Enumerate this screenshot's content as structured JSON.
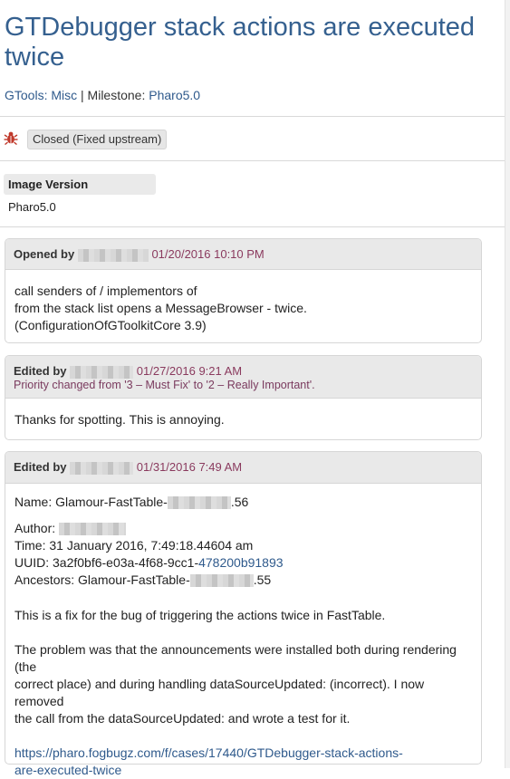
{
  "case": {
    "title": "GTDebugger stack actions are executed twice",
    "project": "GTools: Misc",
    "milestone_label": "Milestone:",
    "milestone": "Pharo5.0",
    "separator": "|",
    "status": "Closed (Fixed upstream)"
  },
  "image_version": {
    "label": "Image Version",
    "value": "Pharo5.0"
  },
  "events": [
    {
      "action": "Opened by",
      "date": "01/20/2016 10:10 PM",
      "lines": [
        "call senders of / implementors of",
        "from the stack list opens a MessageBrowser - twice.",
        "(ConfigurationOfGToolkitCore 3.9)"
      ]
    },
    {
      "action": "Edited by",
      "date": "01/27/2016 9:21 AM",
      "change": "Priority changed from '3 – Must Fix' to '2 – Really Important'.",
      "lines": [
        "Thanks for spotting. This is annoying."
      ]
    },
    {
      "action": "Edited by",
      "date": "01/31/2016 7:49 AM",
      "name_prefix": "Name: Glamour-FastTable-",
      "name_suffix": ".56",
      "author_label": "Author:",
      "time": "Time: 31 January 2016, 7:49:18.44604 am",
      "uuid_prefix": "UUID: 3a2f0bf6-e03a-4f68-9cc1-",
      "uuid_link": "478200b91893",
      "ancestors_prefix": "Ancestors: Glamour-FastTable-",
      "ancestors_suffix": ".55",
      "para1": "This is a fix for the bug of triggering the actions twice in FastTable.",
      "para2_lines": [
        "The problem was that the announcements were installed both during rendering (the",
        "correct place) and during handling dataSourceUpdated: (incorrect). I now removed",
        "the call from the dataSourceUpdated: and wrote a test for it."
      ],
      "url_lines": [
        "https://pharo.fogbugz.com/f/cases/17440/GTDebugger-stack-actions-",
        "are-executed-twice"
      ]
    }
  ],
  "colors": {
    "title": "#35608f",
    "link": "#2f5a8c",
    "date": "#8a3a5e",
    "bug_icon": "#c0392b"
  },
  "icons": {
    "status": "bug-icon"
  }
}
